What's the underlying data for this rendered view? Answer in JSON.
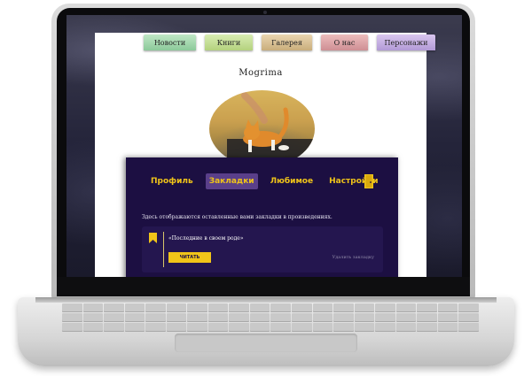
{
  "site_nav": {
    "tabs": [
      {
        "label": "Новости"
      },
      {
        "label": "Книги"
      },
      {
        "label": "Галерея"
      },
      {
        "label": "О нас"
      },
      {
        "label": "Персонажи"
      }
    ]
  },
  "profile": {
    "username": "Mogrima",
    "tabs": [
      {
        "label": "Профиль",
        "active": false
      },
      {
        "label": "Закладки",
        "active": true
      },
      {
        "label": "Любимое",
        "active": false
      },
      {
        "label": "Настройки",
        "active": false
      }
    ],
    "info_text": "Здесь отображаются оставленные вами закладки в произведениях.",
    "bookmarks": [
      {
        "title": "«Последние в своем роде»",
        "read_label": "ЧИТАТЬ",
        "remove_label": "Удалить закладку"
      }
    ]
  },
  "icons": {
    "logout": "door-icon",
    "bookmark": "bookmark-icon"
  },
  "colors": {
    "panel_bg": "#1c0f42",
    "accent_yellow": "#f0c419",
    "active_tab_bg": "#5a3f8a"
  }
}
